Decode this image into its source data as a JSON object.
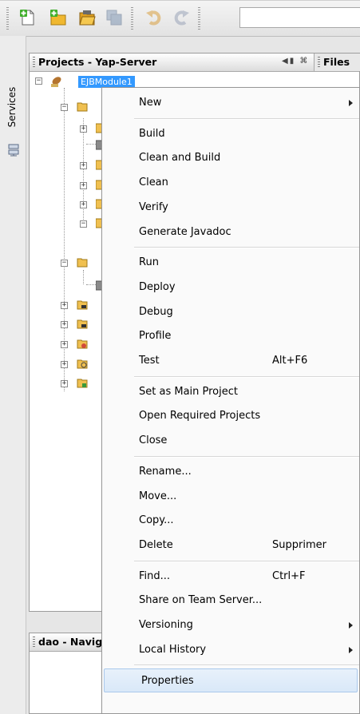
{
  "toolbar": {
    "buttons": [
      {
        "name": "new-file-icon"
      },
      {
        "name": "new-project-icon"
      },
      {
        "name": "open-project-icon"
      },
      {
        "name": "save-all-icon"
      },
      {
        "name": "undo-icon"
      },
      {
        "name": "redo-icon"
      }
    ]
  },
  "left_strip": {
    "services_label": "Services"
  },
  "projects_panel": {
    "title": "Projects - Yap-Server",
    "files_tab": "Files",
    "root_node": "EJBModule1"
  },
  "navigator_panel": {
    "title": "dao - Navigator"
  },
  "context_menu": {
    "items": [
      {
        "label": "New",
        "submenu": true
      },
      {
        "separator": true
      },
      {
        "label": "Build"
      },
      {
        "label": "Clean and Build"
      },
      {
        "label": "Clean"
      },
      {
        "label": "Verify"
      },
      {
        "label": "Generate Javadoc"
      },
      {
        "separator": true
      },
      {
        "label": "Run"
      },
      {
        "label": "Deploy"
      },
      {
        "label": "Debug"
      },
      {
        "label": "Profile"
      },
      {
        "label": "Test",
        "shortcut": "Alt+F6"
      },
      {
        "separator": true
      },
      {
        "label": "Set as Main Project"
      },
      {
        "label": "Open Required Projects"
      },
      {
        "label": "Close"
      },
      {
        "separator": true
      },
      {
        "label": "Rename..."
      },
      {
        "label": "Move..."
      },
      {
        "label": "Copy..."
      },
      {
        "label": "Delete",
        "shortcut": "Supprimer"
      },
      {
        "separator": true
      },
      {
        "label": "Find...",
        "shortcut": "Ctrl+F"
      },
      {
        "label": "Share on Team Server..."
      },
      {
        "label": "Versioning",
        "submenu": true
      },
      {
        "label": "Local History",
        "submenu": true
      },
      {
        "separator": true
      },
      {
        "label": "Properties",
        "hovered": true
      }
    ]
  },
  "colors": {
    "selection": "#3399ff",
    "menu_hover": "#d9e8f8"
  }
}
